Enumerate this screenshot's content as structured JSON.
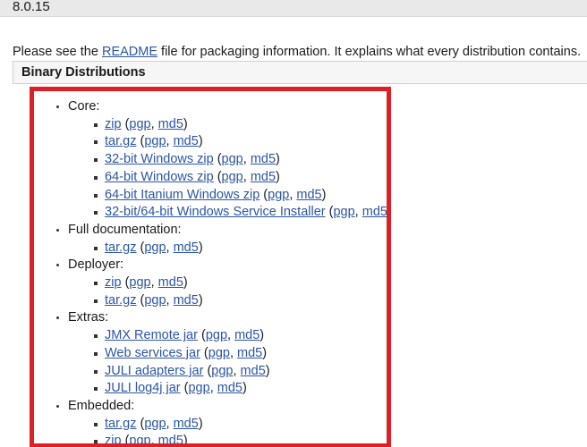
{
  "version_bar": {
    "version": "8.0.15"
  },
  "intro": {
    "before_link": "Please see the ",
    "link_label": "README",
    "after_link": " file for packaging information. It explains what every distribution contains."
  },
  "section": {
    "title": "Binary Distributions"
  },
  "colors": {
    "highlight_red": "#dc2026",
    "link_blue": "#2b56a4",
    "header_gray": "#f6f6f6",
    "version_bar_gray": "#e9e9e9",
    "text": "#1a1a1a"
  },
  "checksum_labels": {
    "pgp": "pgp",
    "md5": "md5",
    "open_paren": "(",
    "close_paren": ")",
    "separator": ", "
  },
  "groups": [
    {
      "label": "Core:",
      "items": [
        {
          "name": "zip"
        },
        {
          "name": "tar.gz"
        },
        {
          "name": "32-bit Windows zip"
        },
        {
          "name": "64-bit Windows zip"
        },
        {
          "name": "64-bit Itanium Windows zip"
        },
        {
          "name": "32-bit/64-bit Windows Service Installer"
        }
      ]
    },
    {
      "label": "Full documentation:",
      "items": [
        {
          "name": "tar.gz"
        }
      ]
    },
    {
      "label": "Deployer:",
      "items": [
        {
          "name": "zip"
        },
        {
          "name": "tar.gz"
        }
      ]
    },
    {
      "label": "Extras:",
      "items": [
        {
          "name": "JMX Remote jar"
        },
        {
          "name": "Web services jar"
        },
        {
          "name": "JULI adapters jar"
        },
        {
          "name": "JULI log4j jar"
        }
      ]
    },
    {
      "label": "Embedded:",
      "items": [
        {
          "name": "tar.gz"
        },
        {
          "name": "zip"
        }
      ]
    }
  ]
}
